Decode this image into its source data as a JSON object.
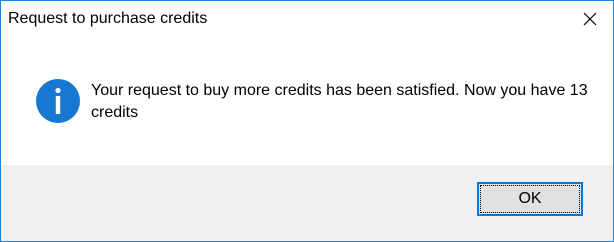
{
  "window": {
    "title": "Request to purchase credits",
    "close_icon": "close-icon"
  },
  "message": {
    "icon": "info-icon",
    "text": "Your request to buy more credits has been satisfied. Now you have 13 credits"
  },
  "buttons": {
    "ok_label": "OK"
  },
  "colors": {
    "window_border": "#1883d7",
    "info_icon": "#1777d2",
    "button_focus_border": "#0078d7",
    "footer_background": "#f0f0f0"
  }
}
